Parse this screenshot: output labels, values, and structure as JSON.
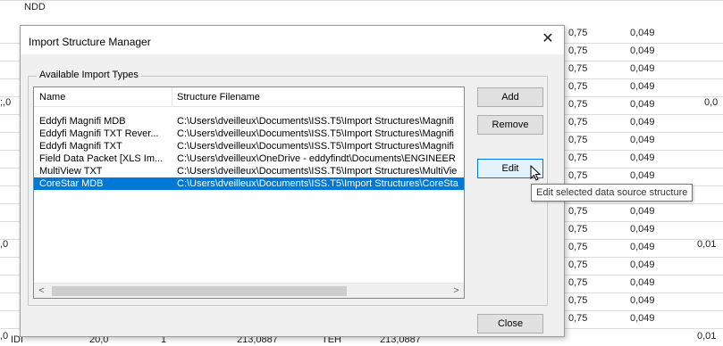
{
  "spreadsheet": {
    "top_label": "NDD",
    "col_a_values": [
      "0,75",
      "0,75",
      "0,75",
      "0,75",
      "0,75",
      "0,75",
      "0,75",
      "0,75",
      "0,75",
      "0,75",
      "0,75",
      "0,75",
      "0,75",
      "0,75",
      "0,75",
      "0,75",
      "0,75"
    ],
    "col_b_values": [
      "0,049",
      "0,049",
      "0,049",
      "0,049",
      "0,049",
      "0,049",
      "0,049",
      "0,049",
      "0,049",
      "0,049",
      "0,049",
      "0,049",
      "0,049",
      "0,049",
      "0,049",
      "0,049",
      "0,049"
    ],
    "side_values": [
      ";,0",
      ",0",
      ",0"
    ],
    "right_values": [
      "0,0",
      "0,01",
      "0,01"
    ],
    "bottom_row": [
      "IDI",
      "20,0",
      "1",
      "213,0887",
      "TEH",
      "213,0887"
    ]
  },
  "dialog": {
    "title": "Import Structure Manager",
    "close_glyph": "✕",
    "group_label": "Available Import Types",
    "columns": [
      "Name",
      "Structure Filename"
    ],
    "rows": [
      {
        "name": "Eddyfi Magnifi MDB",
        "file": "C:\\Users\\dveilleux\\Documents\\ISS.T5\\Import Structures\\Magnifi"
      },
      {
        "name": "Eddyfi Magnifi TXT Rever...",
        "file": "C:\\Users\\dveilleux\\Documents\\ISS.T5\\Import Structures\\Magnifi"
      },
      {
        "name": "Eddyfi Magnifi TXT",
        "file": "C:\\Users\\dveilleux\\Documents\\ISS.T5\\Import Structures\\Magnifi"
      },
      {
        "name": "Field Data Packet [XLS Im...",
        "file": "C:\\Users\\dveilleux\\OneDrive - eddyfindt\\Documents\\ENGINEER"
      },
      {
        "name": "MultiView TXT",
        "file": "C:\\Users\\dveilleux\\Documents\\ISS.T5\\Import Structures\\MultiVie"
      },
      {
        "name": "CoreStar MDB",
        "file": "C:\\Users\\dveilleux\\Documents\\ISS.T5\\Import Structures\\CoreSta"
      }
    ],
    "selected_row": 5,
    "buttons": {
      "add": "Add",
      "remove": "Remove",
      "edit": "Edit",
      "close": "Close"
    },
    "scroll_left": "<",
    "scroll_right": ">",
    "tooltip": "Edit selected data source structure"
  },
  "colors": {
    "selection": "#0078d7",
    "hover_border": "#0078d7"
  }
}
